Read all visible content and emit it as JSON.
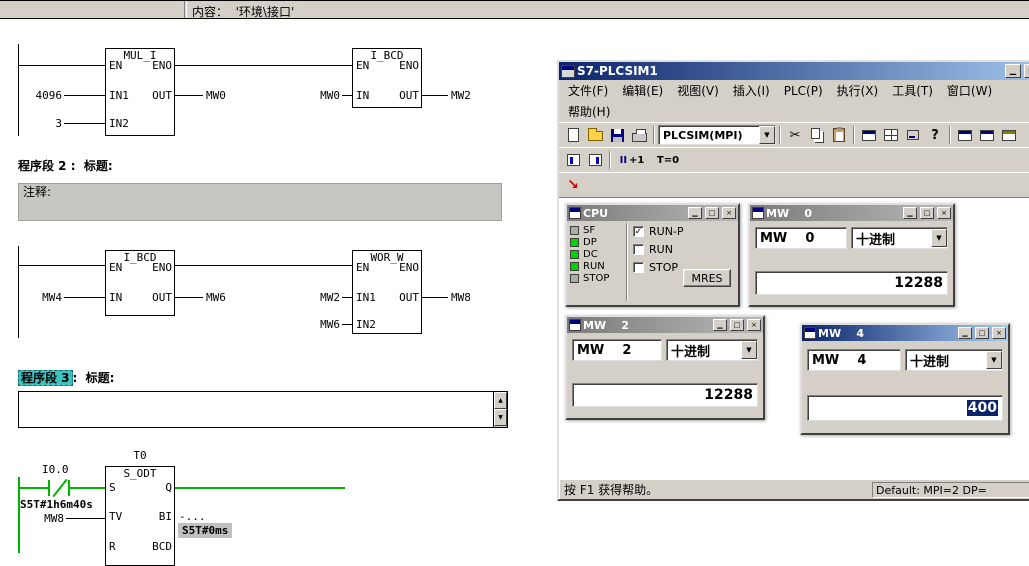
{
  "top_bar": {
    "content": "内容：  '环境\\接口'"
  },
  "glyphs": {
    "min": "▁",
    "max": "□",
    "close": "×",
    "up": "▲",
    "down": "▼",
    "dropdown": "▼",
    "cut": "✂",
    "help": "?",
    "red_arrow": "↘",
    "check": "✓"
  },
  "colors": {
    "power_flow_green": "#00b400",
    "led_on_green": "#00d300",
    "selection_blue": "#0a246a",
    "highlight_teal": "#3ec1c1",
    "chrome_gray": "#d4d0c8"
  },
  "editor": {
    "net2_header": "程序段 2 :  标题:",
    "net3_header_sel": "程序段 3",
    "net3_header_rest": ":  标题:",
    "comment": "注释:",
    "labels": {
      "en": "EN",
      "eno": "ENO",
      "in": "IN",
      "in1": "IN1",
      "in2": "IN2",
      "out": "OUT",
      "s": "S",
      "q": "Q",
      "tv": "TV",
      "bi": "BI",
      "r": "R",
      "bcd": "BCD"
    },
    "n1": {
      "b1_title": "MUL_I",
      "b1_in1": "4096",
      "b1_in2": "3",
      "b1_out": "MW0",
      "b2_title": "I_BCD",
      "b2_in": "MW0",
      "b2_out": "MW2"
    },
    "n2": {
      "b1_title": "I_BCD",
      "b1_in": "MW4",
      "b1_out": "MW6",
      "b2_title": "WOR_W",
      "b2_in1": "MW2",
      "b2_in2": "MW6",
      "b2_out": "MW8"
    },
    "n3": {
      "timer": "T0",
      "contact": "I0.0",
      "block": "S_ODT",
      "tv_value": "S5T#1h6m40s",
      "tv_operand": "MW8",
      "bi_out": "-...",
      "bcd_value": "S5T#0ms"
    }
  },
  "plcsim": {
    "title": "S7-PLCSIM1",
    "menu1": [
      "文件(F)",
      "编辑(E)",
      "视图(V)",
      "插入(I)",
      "PLC(P)",
      "执行(X)",
      "工具(T)",
      "窗口(W)"
    ],
    "menu2": [
      "帮助(H)"
    ],
    "toolbar": {
      "interface": "PLCSIM(MPI)",
      "pause": "II",
      "step": "+1",
      "treset": "T=0"
    },
    "cpu": {
      "title": "CPU",
      "leds": [
        {
          "label": "SF",
          "on": false
        },
        {
          "label": "DP",
          "on": true
        },
        {
          "label": "DC",
          "on": true
        },
        {
          "label": "RUN",
          "on": true
        },
        {
          "label": "STOP",
          "on": false
        }
      ],
      "run_p": "RUN-P",
      "run": "RUN",
      "stop": "STOP",
      "mres": "MRES",
      "run_p_checked": true
    },
    "mw0": {
      "title": "MW    0",
      "address": "MW    0",
      "format": "十进制",
      "value": "12288"
    },
    "mw2": {
      "title": "MW    2",
      "address": "MW    2",
      "format": "十进制",
      "value": "12288"
    },
    "mw4": {
      "title": "MW    4",
      "address": "MW    4",
      "format": "十进制",
      "value": "400",
      "value_selected": true
    },
    "status": {
      "help": "按 F1 获得帮助。",
      "right": "Default: MPI=2 DP="
    }
  }
}
